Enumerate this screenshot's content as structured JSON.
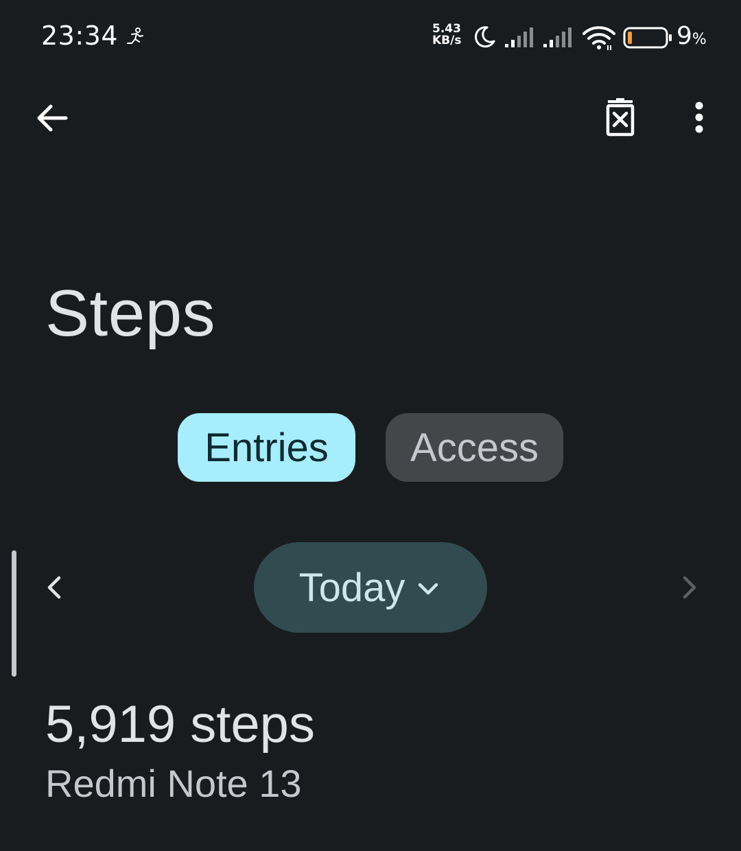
{
  "status_bar": {
    "time": "23:34",
    "network_speed_value": "5.43",
    "network_speed_unit": "KB/s",
    "battery_level": "9",
    "battery_unit": "%",
    "icons": [
      "running-person-icon",
      "moon-icon",
      "signal-icon",
      "signal-icon",
      "wifi-icon",
      "battery-icon"
    ],
    "battery_low_color": "#f29d38"
  },
  "app_bar": {
    "back_icon": "arrow-back-icon",
    "delete_icon": "delete-data-icon",
    "more_icon": "more-vert-icon"
  },
  "page": {
    "title": "Steps"
  },
  "tabs": [
    {
      "label": "Entries",
      "selected": true
    },
    {
      "label": "Access",
      "selected": false
    }
  ],
  "date_nav": {
    "label": "Today",
    "prev_icon": "chevron-left-icon",
    "next_icon": "chevron-right-icon",
    "dropdown_icon": "chevron-down-icon"
  },
  "entries": [
    {
      "value": "5,919 steps",
      "source": "Redmi Note 13"
    }
  ],
  "colors": {
    "background": "#191c1e",
    "tab_selected_bg": "#a6eefe",
    "tab_unselected_bg": "#43474a",
    "date_chip_bg": "#324b50"
  }
}
